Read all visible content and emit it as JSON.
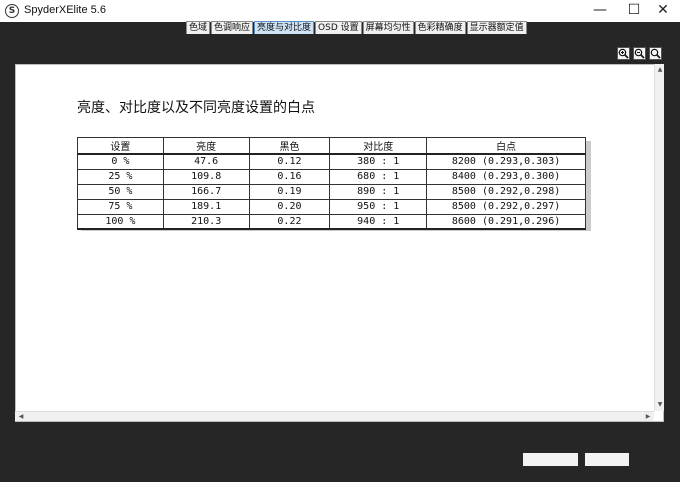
{
  "window": {
    "title": "SpyderXElite 5.6",
    "icon_glyph": "S",
    "controls": {
      "minimize": "—",
      "maximize": "☐",
      "close": "✕"
    }
  },
  "tabs": [
    {
      "label": "色域",
      "active": false
    },
    {
      "label": "色调响应",
      "active": false
    },
    {
      "label": "亮度与对比度",
      "active": true
    },
    {
      "label": "OSD 设置",
      "active": false
    },
    {
      "label": "屏幕均匀性",
      "active": false
    },
    {
      "label": "色彩精确度",
      "active": false
    },
    {
      "label": "显示器额定值",
      "active": false
    }
  ],
  "zoom": {
    "icons": [
      "zoom-in-icon",
      "zoom-out-icon",
      "zoom-fit-icon"
    ]
  },
  "report": {
    "title": "亮度、对比度以及不同亮度设置的白点",
    "table": {
      "headers": [
        "设置",
        "亮度",
        "黑色",
        "对比度",
        "白点"
      ],
      "rows": [
        [
          "0 %",
          "47.6",
          "0.12",
          "380 : 1",
          "8200 (0.293,0.303)"
        ],
        [
          "25 %",
          "109.8",
          "0.16",
          "680 : 1",
          "8400 (0.293,0.300)"
        ],
        [
          "50 %",
          "166.7",
          "0.19",
          "890 : 1",
          "8500 (0.292,0.298)"
        ],
        [
          "75 %",
          "189.1",
          "0.20",
          "950 : 1",
          "8500 (0.292,0.297)"
        ],
        [
          "100 %",
          "210.3",
          "0.22",
          "940 : 1",
          "8600 (0.291,0.296)"
        ]
      ]
    }
  },
  "scrollbars": {
    "up": "▲",
    "down": "▼",
    "left": "◀",
    "right": "▶"
  }
}
